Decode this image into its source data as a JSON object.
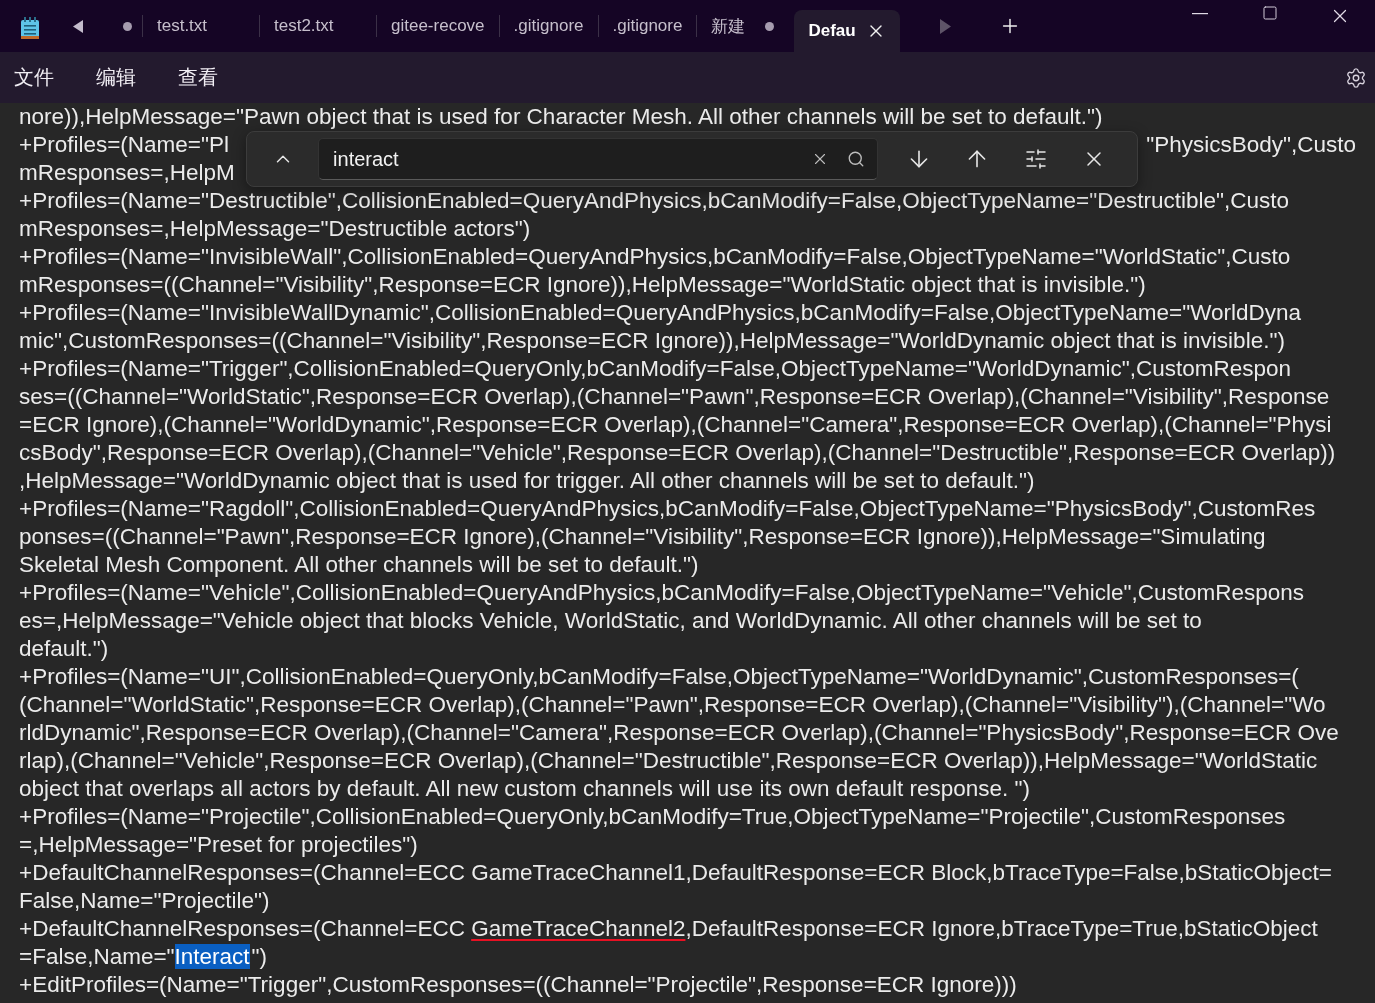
{
  "tabs": [
    {
      "label": "test.txt",
      "selected": false,
      "modified": false
    },
    {
      "label": "test2.txt",
      "selected": false,
      "modified": false
    },
    {
      "label": "gitee-recove",
      "selected": false,
      "modified": false
    },
    {
      "label": ".gitignore",
      "selected": false,
      "modified": false
    },
    {
      "label": ".gitignore",
      "selected": false,
      "modified": false
    },
    {
      "label": "新建",
      "selected": false,
      "modified": true
    },
    {
      "label": "Defau",
      "selected": true,
      "modified": false
    }
  ],
  "menu": [
    {
      "label": "文件"
    },
    {
      "label": "编辑"
    },
    {
      "label": "查看"
    }
  ],
  "find": {
    "value": "interact"
  },
  "editor": {
    "lines": [
      {
        "kind": "text",
        "text": "nore)),HelpMessage=\"Pawn object that is used for Character Mesh. All other channels will be set to default.\")"
      },
      {
        "kind": "split",
        "left": "+Profiles=(Name=\"Pl",
        "right": "\"PhysicsBody\",Custo"
      },
      {
        "kind": "split",
        "left": "mResponses=,HelpM"
      },
      {
        "kind": "text",
        "text": "+Profiles=(Name=\"Destructible\",CollisionEnabled=QueryAndPhysics,bCanModify=False,ObjectTypeName=\"Destructible\",Custo"
      },
      {
        "kind": "text",
        "text": "mResponses=,HelpMessage=\"Destructible actors\")"
      },
      {
        "kind": "text",
        "text": "+Profiles=(Name=\"InvisibleWall\",CollisionEnabled=QueryAndPhysics,bCanModify=False,ObjectTypeName=\"WorldStatic\",Custo"
      },
      {
        "kind": "text",
        "text": "mResponses=((Channel=\"Visibility\",Response=ECR Ignore)),HelpMessage=\"WorldStatic object that is invisible.\")"
      },
      {
        "kind": "text",
        "text": "+Profiles=(Name=\"InvisibleWallDynamic\",CollisionEnabled=QueryAndPhysics,bCanModify=False,ObjectTypeName=\"WorldDyna"
      },
      {
        "kind": "text",
        "text": "mic\",CustomResponses=((Channel=\"Visibility\",Response=ECR Ignore)),HelpMessage=\"WorldDynamic object that is invisible.\")"
      },
      {
        "kind": "text",
        "text": "+Profiles=(Name=\"Trigger\",CollisionEnabled=QueryOnly,bCanModify=False,ObjectTypeName=\"WorldDynamic\",CustomRespon"
      },
      {
        "kind": "text",
        "text": "ses=((Channel=\"WorldStatic\",Response=ECR Overlap),(Channel=\"Pawn\",Response=ECR Overlap),(Channel=\"Visibility\",Response"
      },
      {
        "kind": "text",
        "text": "=ECR Ignore),(Channel=\"WorldDynamic\",Response=ECR Overlap),(Channel=\"Camera\",Response=ECR Overlap),(Channel=\"Physi"
      },
      {
        "kind": "text",
        "text": "csBody\",Response=ECR Overlap),(Channel=\"Vehicle\",Response=ECR Overlap),(Channel=\"Destructible\",Response=ECR Overlap))"
      },
      {
        "kind": "text",
        "text": ",HelpMessage=\"WorldDynamic object that is used for trigger. All other channels will be set to default.\")"
      },
      {
        "kind": "text",
        "text": "+Profiles=(Name=\"Ragdoll\",CollisionEnabled=QueryAndPhysics,bCanModify=False,ObjectTypeName=\"PhysicsBody\",CustomRes"
      },
      {
        "kind": "text",
        "text": "ponses=((Channel=\"Pawn\",Response=ECR Ignore),(Channel=\"Visibility\",Response=ECR Ignore)),HelpMessage=\"Simulating"
      },
      {
        "kind": "text",
        "text": "Skeletal Mesh Component. All other channels will be set to default.\")"
      },
      {
        "kind": "text",
        "text": "+Profiles=(Name=\"Vehicle\",CollisionEnabled=QueryAndPhysics,bCanModify=False,ObjectTypeName=\"Vehicle\",CustomRespons"
      },
      {
        "kind": "text",
        "text": "es=,HelpMessage=\"Vehicle object that blocks Vehicle, WorldStatic, and WorldDynamic. All other channels will be set to"
      },
      {
        "kind": "text",
        "text": "default.\")"
      },
      {
        "kind": "text",
        "text": "+Profiles=(Name=\"UI\",CollisionEnabled=QueryOnly,bCanModify=False,ObjectTypeName=\"WorldDynamic\",CustomResponses=("
      },
      {
        "kind": "text",
        "text": "(Channel=\"WorldStatic\",Response=ECR Overlap),(Channel=\"Pawn\",Response=ECR Overlap),(Channel=\"Visibility\"),(Channel=\"Wo"
      },
      {
        "kind": "text",
        "text": "rldDynamic\",Response=ECR Overlap),(Channel=\"Camera\",Response=ECR Overlap),(Channel=\"PhysicsBody\",Response=ECR Ove"
      },
      {
        "kind": "text",
        "text": "rlap),(Channel=\"Vehicle\",Response=ECR Overlap),(Channel=\"Destructible\",Response=ECR Overlap)),HelpMessage=\"WorldStatic"
      },
      {
        "kind": "text",
        "text": "object that overlaps all actors by default. All new custom channels will use its own default response. \")"
      },
      {
        "kind": "text",
        "text": "+Profiles=(Name=\"Projectile\",CollisionEnabled=QueryOnly,bCanModify=True,ObjectTypeName=\"Projectile\",CustomResponses"
      },
      {
        "kind": "text",
        "text": "=,HelpMessage=\"Preset for projectiles\")"
      },
      {
        "kind": "text",
        "text": "+DefaultChannelResponses=(Channel=ECC GameTraceChannel1,DefaultResponse=ECR Block,bTraceType=False,bStaticObject="
      },
      {
        "kind": "text",
        "text": "False,Name=\"Projectile\")"
      },
      {
        "kind": "rich",
        "segments": [
          {
            "kind": "plain",
            "text": "+DefaultChannelResponses=(Channel=ECC "
          },
          {
            "kind": "misspelled",
            "text": "GameTraceChannel2"
          },
          {
            "kind": "plain",
            "text": ",DefaultResponse=ECR Ignore,bTraceType=True,bStaticObject"
          }
        ]
      },
      {
        "kind": "rich",
        "segments": [
          {
            "kind": "plain",
            "text": "=False,Name=\""
          },
          {
            "kind": "selected",
            "text": "Interact"
          },
          {
            "kind": "plain",
            "text": "\")"
          }
        ]
      },
      {
        "kind": "text",
        "text": "+EditProfiles=(Name=\"Trigger\",CustomResponses=((Channel=\"Projectile\",Response=ECR Ignore)))"
      }
    ]
  }
}
